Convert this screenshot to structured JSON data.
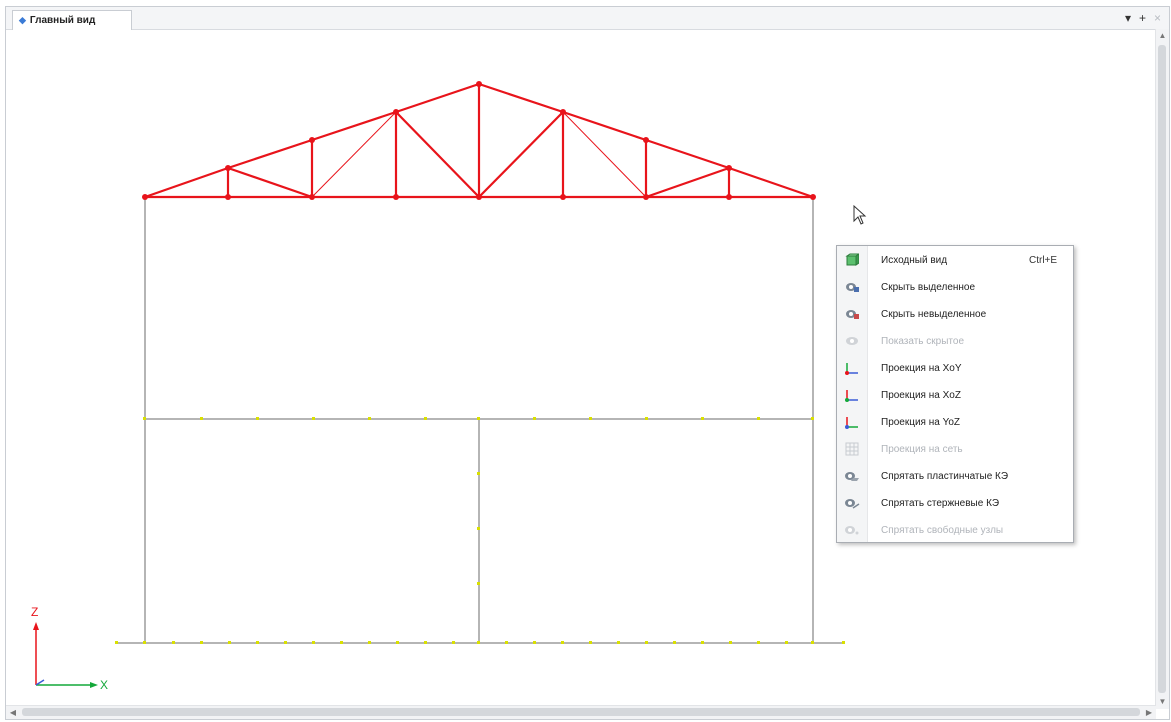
{
  "tab": {
    "title": "Главный вид"
  },
  "context_menu": {
    "items": [
      {
        "label": "Исходный вид",
        "shortcut": "Ctrl+E",
        "icon": "cube-icon",
        "enabled": true
      },
      {
        "label": "Скрыть выделенное",
        "shortcut": "",
        "icon": "eye-hide-icon",
        "enabled": true
      },
      {
        "label": "Скрыть невыделенное",
        "shortcut": "",
        "icon": "eye-hide-icon",
        "enabled": true
      },
      {
        "label": "Показать скрытое",
        "shortcut": "",
        "icon": "eye-show-icon",
        "enabled": false
      },
      {
        "label": "Проекция на XoY",
        "shortcut": "",
        "icon": "axes-xoy-icon",
        "enabled": true
      },
      {
        "label": "Проекция на XoZ",
        "shortcut": "",
        "icon": "axes-xoz-icon",
        "enabled": true
      },
      {
        "label": "Проекция на YoZ",
        "shortcut": "",
        "icon": "axes-yoz-icon",
        "enabled": true
      },
      {
        "label": "Проекция на сеть",
        "shortcut": "",
        "icon": "grid-icon",
        "enabled": false
      },
      {
        "label": "Спрятать пластинчатые КЭ",
        "shortcut": "",
        "icon": "hide-plates-icon",
        "enabled": true
      },
      {
        "label": "Спрятать стержневые КЭ",
        "shortcut": "",
        "icon": "hide-bars-icon",
        "enabled": true
      },
      {
        "label": "Спрятать свободные узлы",
        "shortcut": "",
        "icon": "hide-nodes-icon",
        "enabled": false
      }
    ]
  },
  "axes": {
    "z_label": "Z",
    "x_label": "X"
  },
  "colors": {
    "truss": "#e8141b",
    "frame": "#6b6b6b",
    "nodes": "#d9e000",
    "accent": "#3b7bd6"
  }
}
